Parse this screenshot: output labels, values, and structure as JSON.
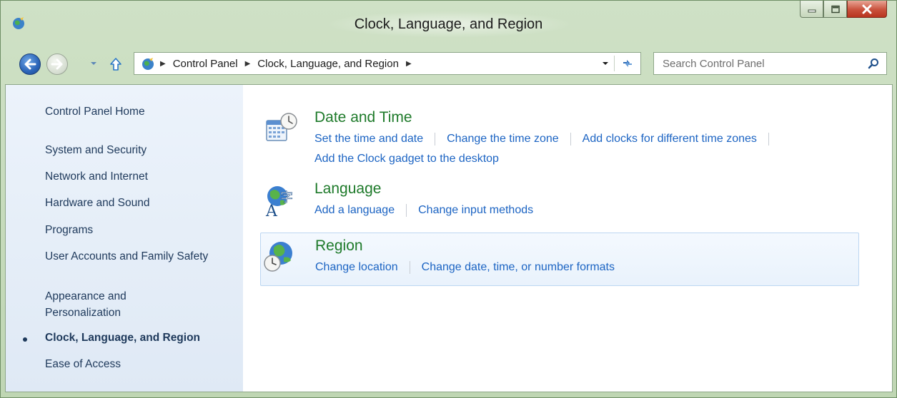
{
  "window": {
    "title": "Clock, Language, and Region"
  },
  "address_bar": {
    "breadcrumbs": [
      "Control Panel",
      "Clock, Language, and Region"
    ]
  },
  "search": {
    "placeholder": "Search Control Panel"
  },
  "nav_pane": {
    "items": [
      {
        "label": "Control Panel Home"
      },
      {
        "label": "System and Security"
      },
      {
        "label": "Network and Internet"
      },
      {
        "label": "Hardware and Sound"
      },
      {
        "label": "Programs"
      },
      {
        "label": "User Accounts and Family Safety"
      },
      {
        "label": "Appearance and Personalization"
      },
      {
        "label": "Clock, Language, and Region",
        "current": true
      },
      {
        "label": "Ease of Access"
      }
    ]
  },
  "categories": [
    {
      "title": "Date and Time",
      "icon": "date-and-time-icon",
      "links": [
        "Set the time and date",
        "Change the time zone",
        "Add clocks for different time zones",
        "Add the Clock gadget to the desktop"
      ]
    },
    {
      "title": "Language",
      "icon": "language-icon",
      "links": [
        "Add a language",
        "Change input methods"
      ]
    },
    {
      "title": "Region",
      "icon": "region-icon",
      "links": [
        "Change location",
        "Change date, time, or number formats"
      ]
    }
  ],
  "colors": {
    "frame": "#c9dcbf",
    "category_title": "#1e7a2a",
    "link": "#1c64c3",
    "nav_text": "#1e395b",
    "nav_pane_bg": "#e6eef8",
    "highlight_border": "#bcd6f1"
  }
}
